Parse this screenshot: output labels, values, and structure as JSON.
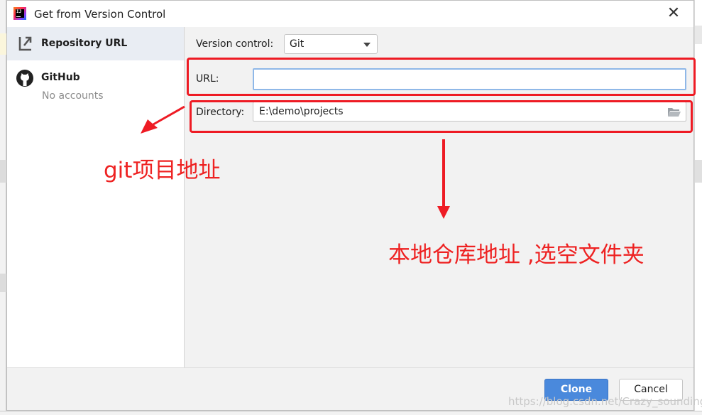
{
  "dialog": {
    "title": "Get from Version Control",
    "close_icon": "close-icon"
  },
  "sidebar": {
    "items": [
      {
        "label": "Repository URL",
        "icon": "vcs-arrow-icon",
        "selected": true
      },
      {
        "label": "GitHub",
        "sublabel": "No accounts",
        "icon": "github-icon",
        "selected": false
      }
    ]
  },
  "form": {
    "version_control_label": "Version control:",
    "version_control_value": "Git",
    "url_label": "URL:",
    "url_value": "",
    "directory_label": "Directory:",
    "directory_value": "E:\\demo\\projects"
  },
  "buttons": {
    "clone": "Clone",
    "cancel": "Cancel"
  },
  "annotations": {
    "git_address": "git项目地址",
    "local_repo": "本地仓库地址 ,选空文件夹",
    "color": "#ee1b24"
  },
  "watermark": "https://blog.csdn.net/Crazy_sounding",
  "colors": {
    "accent": "#4a89dc",
    "focus_border": "#8fb8e8",
    "selected_sidebar": "#e9edf3"
  }
}
